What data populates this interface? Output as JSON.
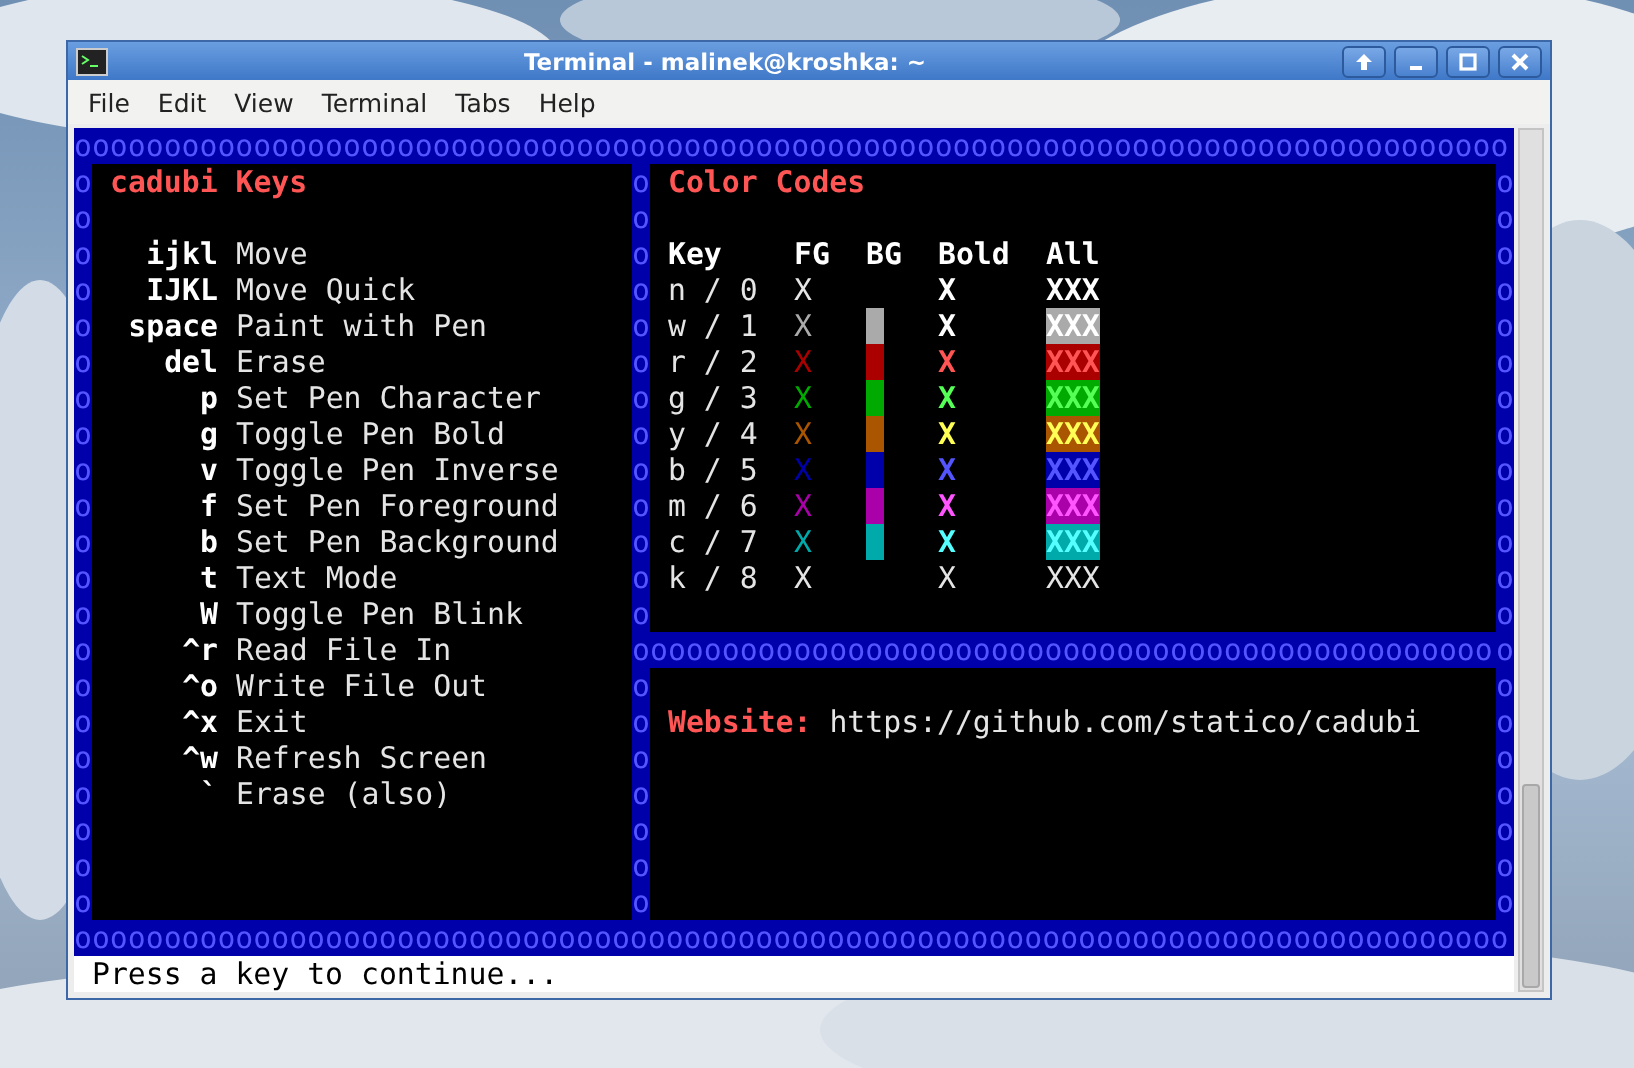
{
  "window": {
    "title": "Terminal - malinek@kroshka: ~",
    "menu": [
      "File",
      "Edit",
      "View",
      "Terminal",
      "Tabs",
      "Help"
    ]
  },
  "terminal": {
    "top_border": "oooooooooooooooooooooooooooooooooooooooooooooooooooooooooooooooooooooooooooooooo",
    "left_border": "ooooooooooooooooooooo",
    "middle_border": "ooooooooooooooooooooo",
    "right_border": "ooooooooooooooooooooo",
    "divider": "ooooooooooooooooooooooooooooooooooooooooooooooo",
    "bottom_border": "oooooooooooooooooooooooooooooooooooooooooooooooooooooooooooooooooooooooooooooooo",
    "keys_panel": {
      "title": "cadubi Keys",
      "items": [
        {
          "key": "ijkl",
          "action": "Move"
        },
        {
          "key": "IJKL",
          "action": "Move Quick"
        },
        {
          "key": "space",
          "action": "Paint with Pen"
        },
        {
          "key": "del",
          "action": "Erase"
        },
        {
          "key": "p",
          "action": "Set Pen Character"
        },
        {
          "key": "g",
          "action": "Toggle Pen Bold"
        },
        {
          "key": "v",
          "action": "Toggle Pen Inverse"
        },
        {
          "key": "f",
          "action": "Set Pen Foreground"
        },
        {
          "key": "b",
          "action": "Set Pen Background"
        },
        {
          "key": "t",
          "action": "Text Mode"
        },
        {
          "key": "W",
          "action": "Toggle Pen Blink"
        },
        {
          "key": "^r",
          "action": "Read File In"
        },
        {
          "key": "^o",
          "action": "Write File Out"
        },
        {
          "key": "^x",
          "action": "Exit"
        },
        {
          "key": "^w",
          "action": "Refresh Screen"
        },
        {
          "key": "`",
          "action": "Erase (also)"
        }
      ]
    },
    "colors_panel": {
      "title": "Color Codes",
      "columns": [
        "Key",
        "FG",
        "BG",
        "Bold",
        "All"
      ],
      "rows": [
        {
          "key": "n / 0",
          "fg": {
            "text": "X",
            "color": "#e5e5e5"
          },
          "bold": {
            "text": "X",
            "color": "#ffffff",
            "bold": true
          },
          "all": {
            "text": "XXX"
          }
        },
        {
          "key": "w / 1",
          "fg": {
            "text": "X",
            "color": "#aaaaaa"
          },
          "bg": {
            "color": "#aaaaaa"
          },
          "bold": {
            "text": "X",
            "color": "#ffffff",
            "bold": true
          },
          "all": {
            "text": "XXX"
          }
        },
        {
          "key": "r / 2",
          "fg": {
            "text": "X",
            "color": "#aa0000"
          },
          "bg": {
            "color": "#aa0000"
          },
          "bold": {
            "text": "X",
            "color": "#ff5555",
            "bold": true
          },
          "all": {
            "text": "XXX"
          }
        },
        {
          "key": "g / 3",
          "fg": {
            "text": "X",
            "color": "#00aa00"
          },
          "bg": {
            "color": "#00aa00"
          },
          "bold": {
            "text": "X",
            "color": "#55ff55",
            "bold": true
          },
          "all": {
            "text": "XXX"
          }
        },
        {
          "key": "y / 4",
          "fg": {
            "text": "X",
            "color": "#aa5500"
          },
          "bg": {
            "color": "#aa5500"
          },
          "bold": {
            "text": "X",
            "color": "#ffff55",
            "bold": true
          },
          "all": {
            "text": "XXX"
          }
        },
        {
          "key": "b / 5",
          "fg": {
            "text": "X",
            "color": "#0000aa"
          },
          "bg": {
            "color": "#0000aa"
          },
          "bold": {
            "text": "X",
            "color": "#5555ff",
            "bold": true
          },
          "all": {
            "text": "XXX"
          }
        },
        {
          "key": "m / 6",
          "fg": {
            "text": "X",
            "color": "#aa00aa"
          },
          "bg": {
            "color": "#aa00aa"
          },
          "bold": {
            "text": "X",
            "color": "#ff55ff",
            "bold": true
          },
          "all": {
            "text": "XXX"
          }
        },
        {
          "key": "c / 7",
          "fg": {
            "text": "X",
            "color": "#00aaaa"
          },
          "bg": {
            "color": "#00aaaa"
          },
          "bold": {
            "text": "X",
            "color": "#55ffff",
            "bold": true
          },
          "all": {
            "text": "XXX"
          }
        },
        {
          "key": "k / 8",
          "fg": {
            "text": "X",
            "color": "#e5e5e5"
          },
          "bold": {
            "text": "X",
            "color": "#e5e5e5",
            "bold": false
          },
          "all": {
            "text": "XXX"
          }
        }
      ]
    },
    "website": {
      "label": "Website:",
      "url": "https://github.com/statico/cadubi"
    },
    "prompt": "Press a key to continue..."
  }
}
